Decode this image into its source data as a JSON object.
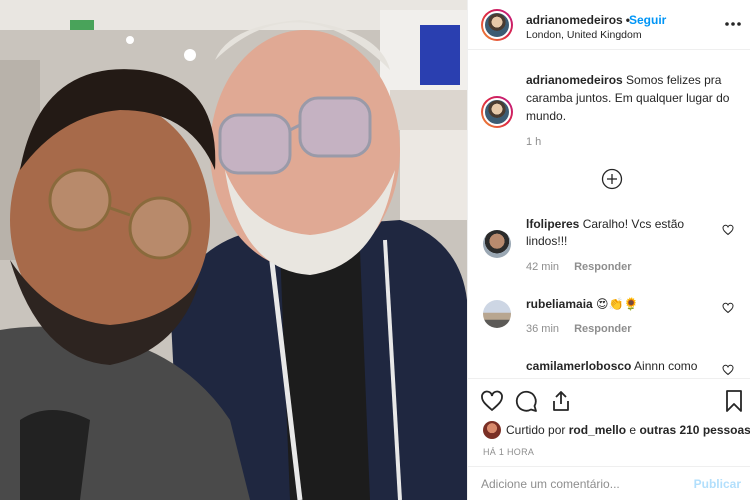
{
  "post": {
    "username": "adrianomedeiros",
    "follow_label": "Seguir",
    "location": "London, United Kingdom",
    "caption": "Somos felizes pra caramba juntos. Em qualquer lugar do mundo.",
    "caption_time": "1 h"
  },
  "comments": [
    {
      "user": "lfoliperes",
      "text": "Caralho! Vcs estão lindos!!!",
      "time": "42 min",
      "reply": "Responder"
    },
    {
      "user": "rubeliamaia",
      "text": "😍👏🌻",
      "time": "36 min",
      "reply": "Responder"
    },
    {
      "user": "camilamerlobosco",
      "text": "Ainnn como",
      "time": "",
      "reply": ""
    }
  ],
  "likes": {
    "prefix": "Curtido por",
    "user": "rod_mello",
    "conjunction": "e",
    "others": "outras 210 pessoas"
  },
  "timestamp": "HÁ 1 HORA",
  "comment_box": {
    "placeholder": "Adicione um comentário...",
    "publish_label": "Publicar"
  },
  "colors": {
    "link_blue": "#0095f6",
    "publish_disabled": "#b2dffc",
    "muted": "#8e8e8e",
    "text": "#262626"
  }
}
